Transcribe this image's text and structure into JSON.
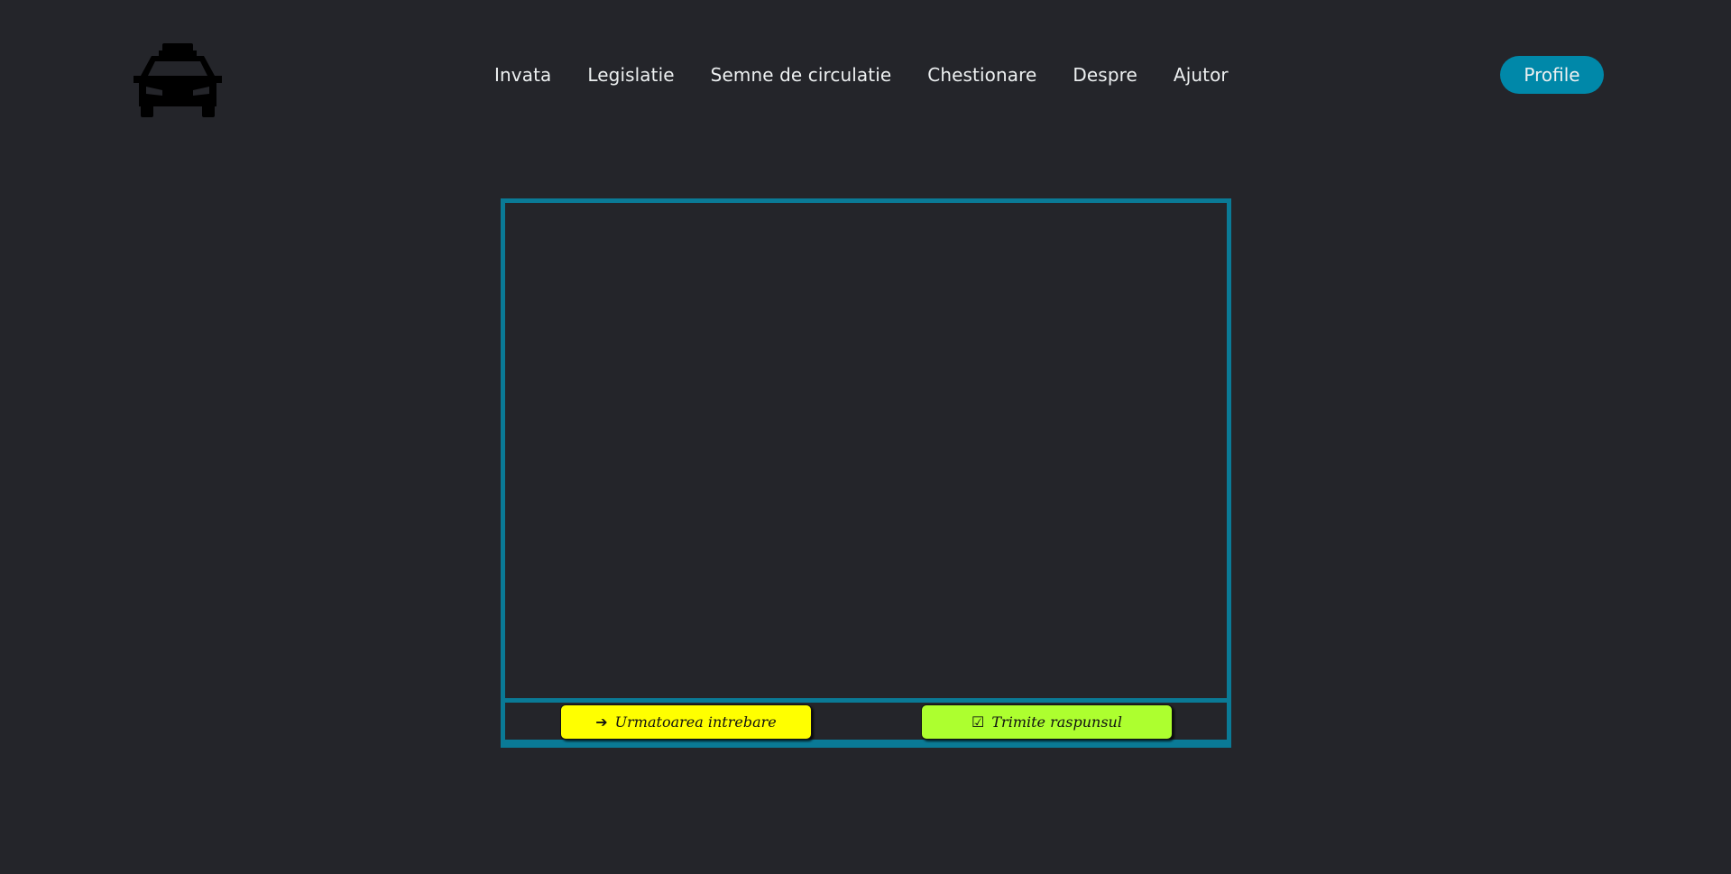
{
  "logo": {
    "icon": "taxi-icon"
  },
  "nav": {
    "items": [
      {
        "label": "Invata"
      },
      {
        "label": "Legislatie"
      },
      {
        "label": "Semne de circulatie"
      },
      {
        "label": "Chestionare"
      },
      {
        "label": "Despre"
      },
      {
        "label": "Ajutor"
      }
    ]
  },
  "profile": {
    "label": "Profile"
  },
  "quiz": {
    "next_icon": "➔",
    "next_label": "Urmatoarea intrebare",
    "submit_icon": "☑",
    "submit_label": "Trimite raspunsul"
  },
  "colors": {
    "background": "#24252a",
    "accent": "#0088a9",
    "frame": "#0a7a96",
    "next_button": "#ffff00",
    "submit_button": "#adff2f"
  }
}
